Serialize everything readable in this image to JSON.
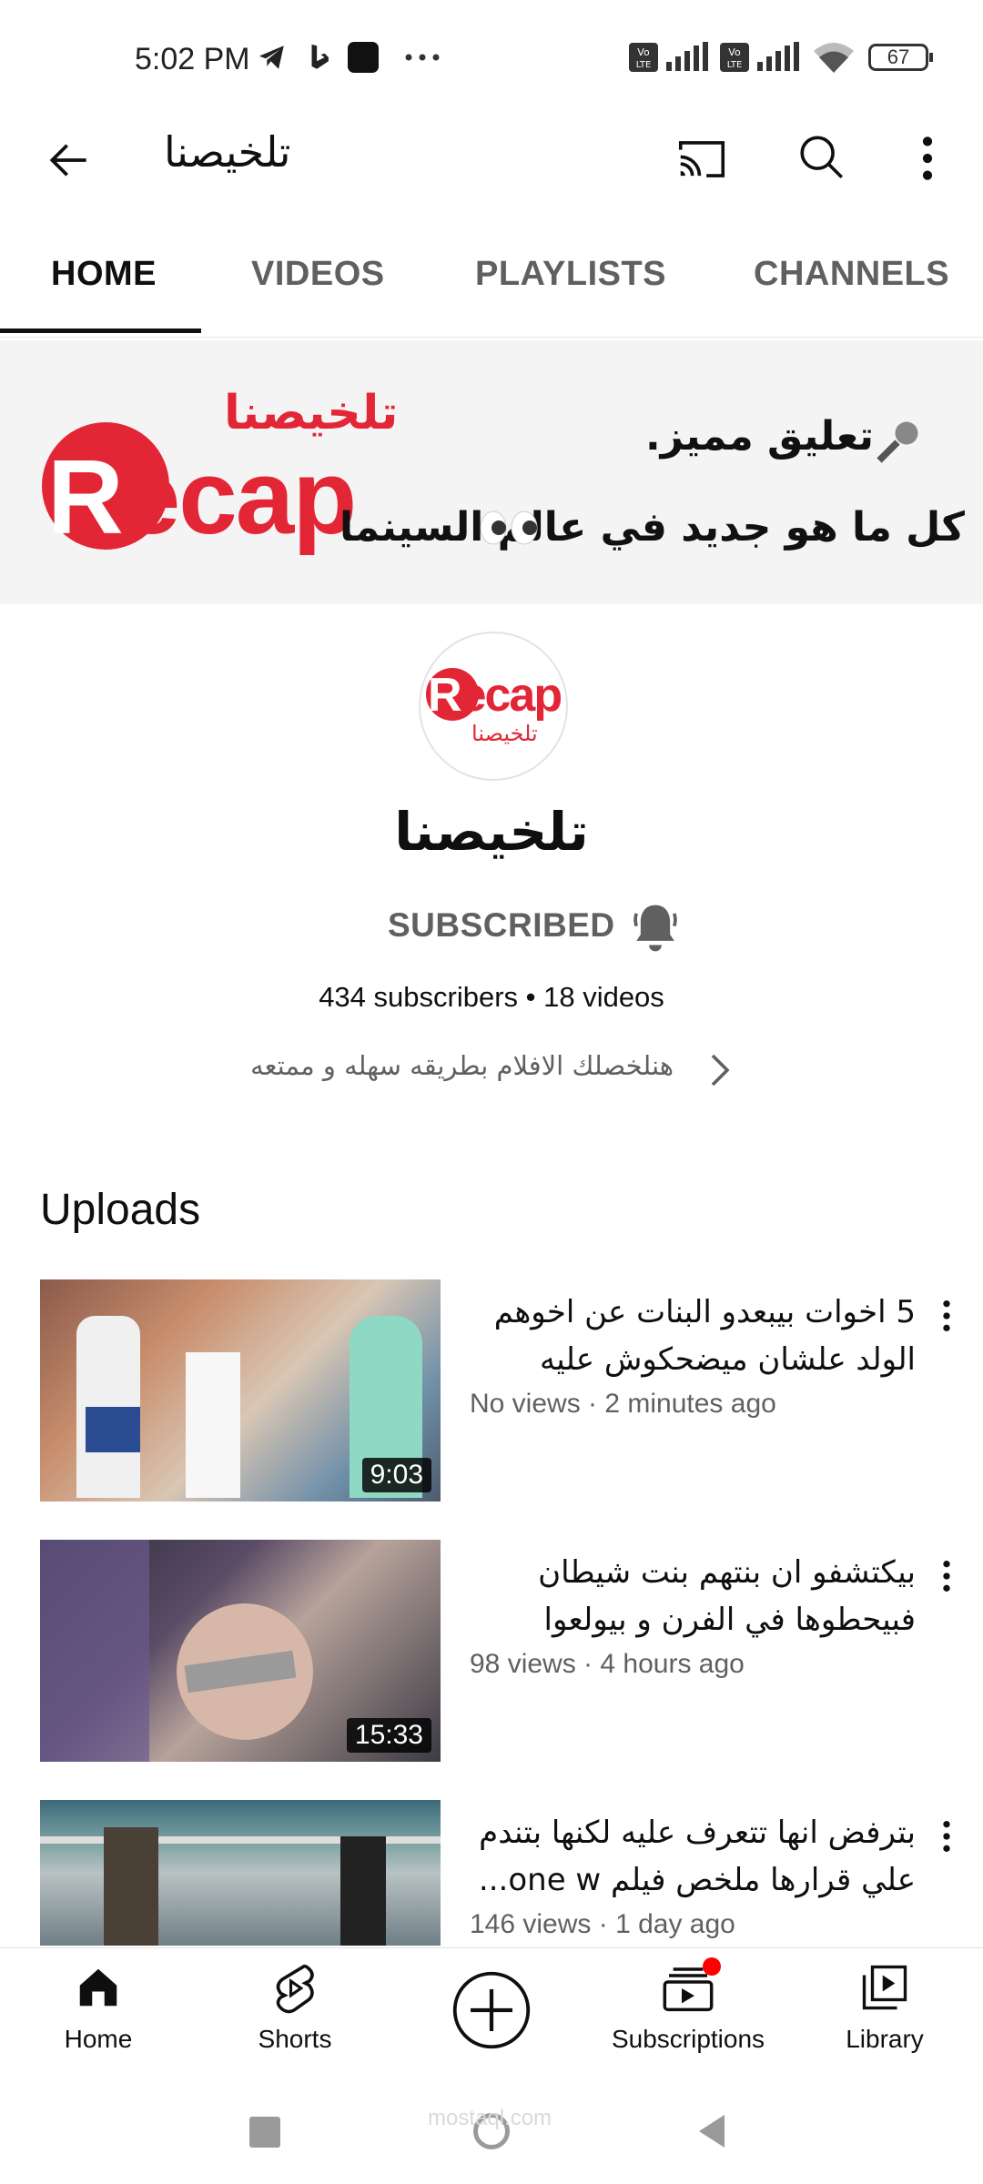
{
  "status_bar": {
    "time": "5:02 PM",
    "battery": "67",
    "icons": [
      "telegram-icon",
      "bing-icon",
      "app-icon",
      "more-dots-icon",
      "volte-icon",
      "signal-icon",
      "volte-icon",
      "signal-icon",
      "wifi-icon",
      "battery-icon"
    ]
  },
  "top_bar": {
    "title": "تلخيصنا",
    "icons": [
      "back-arrow-icon",
      "cast-icon",
      "search-icon",
      "more-vert-icon"
    ]
  },
  "tabs": [
    {
      "label": "HOME",
      "active": true
    },
    {
      "label": "VIDEOS",
      "active": false
    },
    {
      "label": "PLAYLISTS",
      "active": false
    },
    {
      "label": "CHANNELS",
      "active": false
    }
  ],
  "banner": {
    "logo_text": "Recap",
    "logo_arabic": "تلخيصنا",
    "tagline_1": "تعليق مميز.",
    "tagline_2": "كل ما هو جديد في عالم السينما"
  },
  "channel": {
    "avatar_text": "Recap",
    "avatar_arabic": "تلخيصنا",
    "name": "تلخيصنا",
    "subscribe_state": "SUBSCRIBED",
    "stats": "434 subscribers • 18 videos",
    "description": "هنلخصلك الافلام بطريقه سهله و ممتعه"
  },
  "uploads": {
    "title": "Uploads",
    "videos": [
      {
        "title": "5 اخوات بيبعدو البنات عن اخوهم الولد علشان ميضحكوش عليه مل...",
        "meta": "No views · 2 minutes ago",
        "duration": "9:03"
      },
      {
        "title": "بيكتشفو ان بنتهم بنت شيطان فبيحطوها في الفرن و بيولعوا فيه...",
        "meta": "98 views · 4 hours ago",
        "duration": "15:33"
      },
      {
        "title": "بترفض انها تتعرف عليه لكنها بتندم علي قرارها ملخص فيلم one w...",
        "meta": "146 views · 1 day ago",
        "duration": ""
      }
    ]
  },
  "bottom_nav": [
    {
      "label": "Home",
      "icon": "home-icon"
    },
    {
      "label": "Shorts",
      "icon": "shorts-icon"
    },
    {
      "label": "",
      "icon": "create-plus-icon"
    },
    {
      "label": "Subscriptions",
      "icon": "subscriptions-icon"
    },
    {
      "label": "Library",
      "icon": "library-icon"
    }
  ],
  "watermark": "mostaql.com",
  "colors": {
    "brand_red": "#e32636",
    "notification_dot": "#ff0000"
  }
}
